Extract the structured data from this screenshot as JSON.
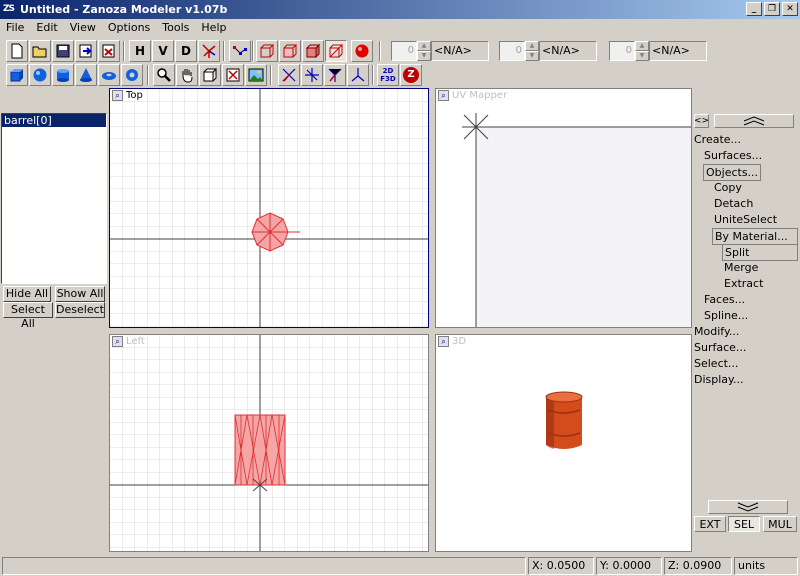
{
  "window": {
    "title": "Untitled - Zanoza Modeler v1.07b",
    "app_icon": "ZS"
  },
  "menu": [
    "File",
    "Edit",
    "View",
    "Options",
    "Tools",
    "Help"
  ],
  "toolbar1": {
    "h_label": "H",
    "v_label": "V",
    "d_label": "D",
    "spinners": [
      {
        "value": "0",
        "label": "<N/A>"
      },
      {
        "value": "0",
        "label": "<N/A>"
      },
      {
        "value": "0",
        "label": "<N/A>"
      }
    ]
  },
  "toolbar2": {
    "twoD_label": "2D",
    "f3d_label": "F3D",
    "z_label": "Z"
  },
  "object_list": {
    "items": [
      "barrel[0]"
    ]
  },
  "list_buttons": {
    "hide_all": "Hide All",
    "show_all": "Show All",
    "select_all": "Select All",
    "deselect": "Deselect"
  },
  "viewports": {
    "top": "Top",
    "uv": "UV Mapper",
    "left": "Left",
    "three_d": "3D"
  },
  "right_panel": {
    "toggle_label": "<>",
    "items": [
      "Create...",
      "Surfaces...",
      "Objects...",
      "Copy",
      "Detach",
      "UniteSelect",
      "By Material...",
      "Split",
      "Merge",
      "Extract",
      "Faces...",
      "Spline...",
      "Modify...",
      "Surface...",
      "Select...",
      "Display..."
    ],
    "modes": [
      "EXT",
      "SEL",
      "MUL"
    ],
    "active_mode": "SEL"
  },
  "status": {
    "x": "X: 0.0500",
    "y": "Y: 0.0000",
    "z": "Z: 0.0900",
    "units": "units"
  },
  "colors": {
    "title_start": "#0a246a",
    "title_end": "#a6caf0",
    "object_fill": "#f4a6a6",
    "object_stroke": "#e03030",
    "barrel": "#d44b1c",
    "grid": "#d8d8d8",
    "axis": "#404040"
  }
}
